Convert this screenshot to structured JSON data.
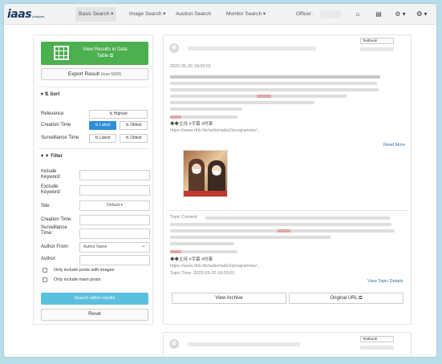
{
  "nav": {
    "logo": "iaas",
    "logo_sub": "Analyzer",
    "items": [
      "Basic Search ▾",
      "Image Search ▾",
      "Auction Search",
      "Monitor Search ▾"
    ],
    "officer_label": "Officer :",
    "icons": [
      "home-icon",
      "book-icon",
      "settings-icon",
      "help-icon"
    ],
    "icon_glyphs": [
      "⌂",
      "▤",
      "⚙ ▾",
      "❂ ▾"
    ]
  },
  "sidebar": {
    "results_button": "View Results in Data Table ⧉",
    "export_label": "Export Result",
    "export_limit": "(max 5000)",
    "sort_title": "▾ ⇅ Sort",
    "sort_rows": [
      {
        "label": "Relevance",
        "options": [
          "⇅ Highest"
        ]
      },
      {
        "label": "Creation Time",
        "options": [
          "⇅ Latest",
          "⇅ Oldest"
        ]
      },
      {
        "label": "Surveillance Time",
        "options": [
          "⇅ Latest",
          "⇅ Oldest"
        ]
      }
    ],
    "filter_title": "▾ ▼ Filter",
    "filter_labels": [
      "Include Keyword:",
      "Exclude Keyword:",
      "Site:",
      "Creation Time:",
      "Surveillance Time:",
      "Author From:",
      "Author:"
    ],
    "site_value": "Default ▾",
    "author_from_value": "Author Name",
    "author_from_arrow": "⌄",
    "checkboxes": [
      "Only include posts with images",
      "Only include main posts"
    ],
    "search_button": "Search within results",
    "reset_button": "Reset"
  },
  "post": {
    "label_tag": "Textbook",
    "date": "2022-05-20 18:00:01",
    "emoji_line": "◆◆主持 #字幕 #时事",
    "url_text": "https://www.rthk.hk/radio/radio2/programme/...",
    "read_more": "Read More",
    "topic_content_label": "Topic Content",
    "topic_time_label": "Topic Time",
    "topic_time_value": "2022-05-20 18:00:01",
    "view_topic_details": "View Topic Details",
    "view_archive": "View Archive",
    "original_url": "Original URL ⧉"
  },
  "post2": {
    "label_tag": "Textbook"
  },
  "colors": {
    "green": "#4caf50",
    "blue": "#2f8ed8",
    "cyan": "#5bc0de",
    "frame": "#b9dde9"
  }
}
